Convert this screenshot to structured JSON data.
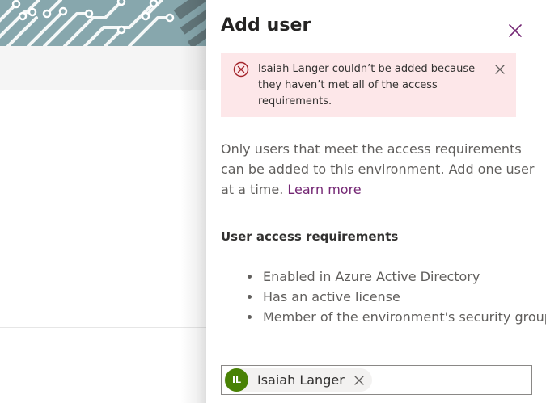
{
  "panel": {
    "title": "Add user",
    "close_icon": "close-icon",
    "error": {
      "icon": "error-circle-icon",
      "message": "Isaiah Langer couldn’t be added because they haven’t met all of the access requirements.",
      "dismiss_icon": "close-icon",
      "background_color": "#fde7e9",
      "icon_color": "#a4262c"
    },
    "description": "Only users that meet the access requirements can be added to this environment. Add one user at a time.",
    "learn_more_link": "Learn more",
    "requirements": {
      "heading": "User access requirements",
      "items": [
        "Enabled in Azure Active Directory",
        "Has an active license",
        "Member of the environment's security group"
      ]
    },
    "people_picker": {
      "selected": [
        {
          "initials": "IL",
          "name": "Isaiah Langer",
          "avatar_color": "#498205",
          "remove_icon": "close-icon"
        }
      ]
    }
  },
  "colors": {
    "accent": "#742774",
    "text_primary": "#323130",
    "text_secondary": "#605e5c"
  }
}
